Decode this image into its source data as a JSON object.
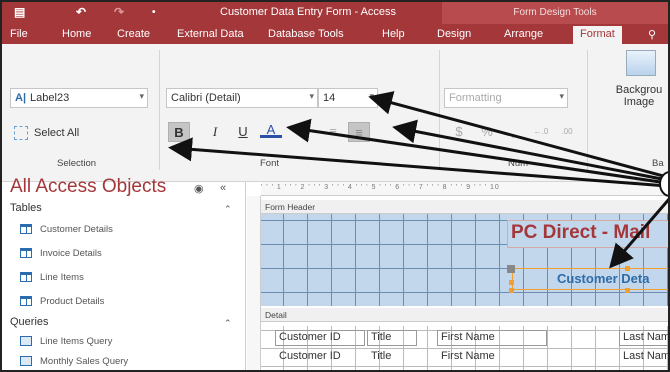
{
  "title_bar": {
    "title": "Customer Data Entry Form  -  Access",
    "context_title": "Form Design Tools",
    "save_icon": "save-icon",
    "undo_icon": "undo-icon",
    "redo_icon": "redo-icon",
    "customize_icon": "customize-qat-icon"
  },
  "tabs": {
    "file": "File",
    "home": "Home",
    "create": "Create",
    "external": "External Data",
    "dbtools": "Database Tools",
    "help": "Help",
    "design": "Design",
    "arrange": "Arrange",
    "format": "Format"
  },
  "ribbon": {
    "selection": {
      "object_value": "Label23",
      "select_all": "Select All",
      "group_label": "Selection"
    },
    "font": {
      "font_value": "Calibri (Detail)",
      "size_value": "14",
      "bold": "B",
      "italic": "I",
      "underline": "U",
      "font_color": "A",
      "group_label": "Font"
    },
    "number": {
      "formatting_placeholder": "Formatting",
      "dollar": "$",
      "percent": "%",
      "comma": ",",
      "inc_decimals": "¹⁰",
      "dec_decimals": ".00",
      "group_label": "Num"
    },
    "background": {
      "label_line1": "Backgrou",
      "label_line2": "Image",
      "group_label": "Ba"
    }
  },
  "nav_pane": {
    "title": "All Access Objects",
    "tables_header": "Tables",
    "tables": [
      "Customer Details",
      "Invoice Details",
      "Line Items",
      "Product Details"
    ],
    "queries_header": "Queries",
    "queries": [
      "Line Items Query",
      "Monthly Sales Query"
    ]
  },
  "design_view": {
    "ruler": "' ' ' 1 ' ' ' 2 ' ' ' 3 ' ' ' 4 ' ' ' 5 ' ' ' 6 ' ' ' 7 ' ' ' 8 ' ' ' 9 ' ' ' 10",
    "form_header": "Form Header",
    "header_title": "PC Direct - Mail",
    "header_subtitle": "Customer Deta",
    "detail": "Detail",
    "detail_labels": [
      "Customer ID",
      "Title",
      "First Name",
      "Last Nam"
    ],
    "detail_fields": [
      "Customer ID",
      "Title",
      "First Name",
      "Last Nam"
    ]
  },
  "colors": {
    "accent": "#a4373a",
    "header_bg": "#c2d6ec",
    "subtitle_text": "#2e6ca8"
  }
}
